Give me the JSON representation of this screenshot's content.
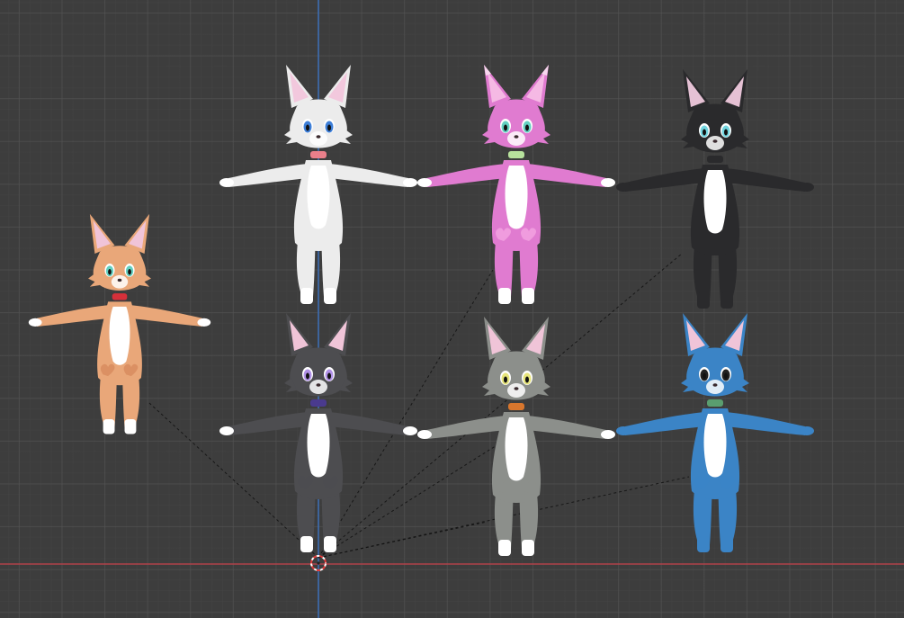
{
  "viewport": {
    "background": "#3d3d3d",
    "x_axis_color": "#b0424a",
    "z_axis_color": "#3b6fb8",
    "relationship_line_color": "#111111"
  },
  "characters": [
    {
      "id": "orange",
      "body": "#e9a779",
      "belly": "#ffffff",
      "ear_inner": "#f0c4d8",
      "eye": "#63d0c1",
      "collar": "#d6303a",
      "feet": "#ffffff",
      "hands": "#ffffff",
      "marks": "#d98e60"
    },
    {
      "id": "white",
      "body": "#ececec",
      "belly": "#ffffff",
      "ear_inner": "#f2c8dd",
      "eye": "#3e7fd8",
      "collar": "#ea7f8a",
      "feet": "#ffffff",
      "hands": "#ffffff",
      "marks": "#ececec"
    },
    {
      "id": "pink",
      "body": "#e07bd0",
      "belly": "#ffffff",
      "ear_inner": "#f5b9e4",
      "eye": "#63d0c1",
      "collar": "#b7e29c",
      "feet": "#ffffff",
      "hands": "#ffffff",
      "marks": "#f2a0df"
    },
    {
      "id": "black",
      "body": "#2a2a2c",
      "belly": "#ffffff",
      "ear_inner": "#e5c1d4",
      "eye": "#73d6e0",
      "collar": "#2a2a2c",
      "feet": "#2a2a2c",
      "hands": "#2a2a2c",
      "marks": "#2a2a2c"
    },
    {
      "id": "dark-grey",
      "body": "#4d4d50",
      "belly": "#ffffff",
      "ear_inner": "#f0c4d8",
      "eye": "#b090e6",
      "collar": "#4a3a8e",
      "feet": "#ffffff",
      "hands": "#ffffff",
      "marks": "#4d4d50"
    },
    {
      "id": "light-grey",
      "body": "#8c8f8b",
      "belly": "#ffffff",
      "ear_inner": "#f0c4d8",
      "eye": "#e6e47a",
      "collar": "#d8762d",
      "feet": "#ffffff",
      "hands": "#ffffff",
      "marks": "#8c8f8b"
    },
    {
      "id": "blue",
      "body": "#3b84c6",
      "belly": "#ffffff",
      "ear_inner": "#f0c4d8",
      "eye": "#222222",
      "collar": "#5a9e6f",
      "feet": "#3b84c6",
      "hands": "#3b84c6",
      "marks": "#3b84c6"
    }
  ]
}
